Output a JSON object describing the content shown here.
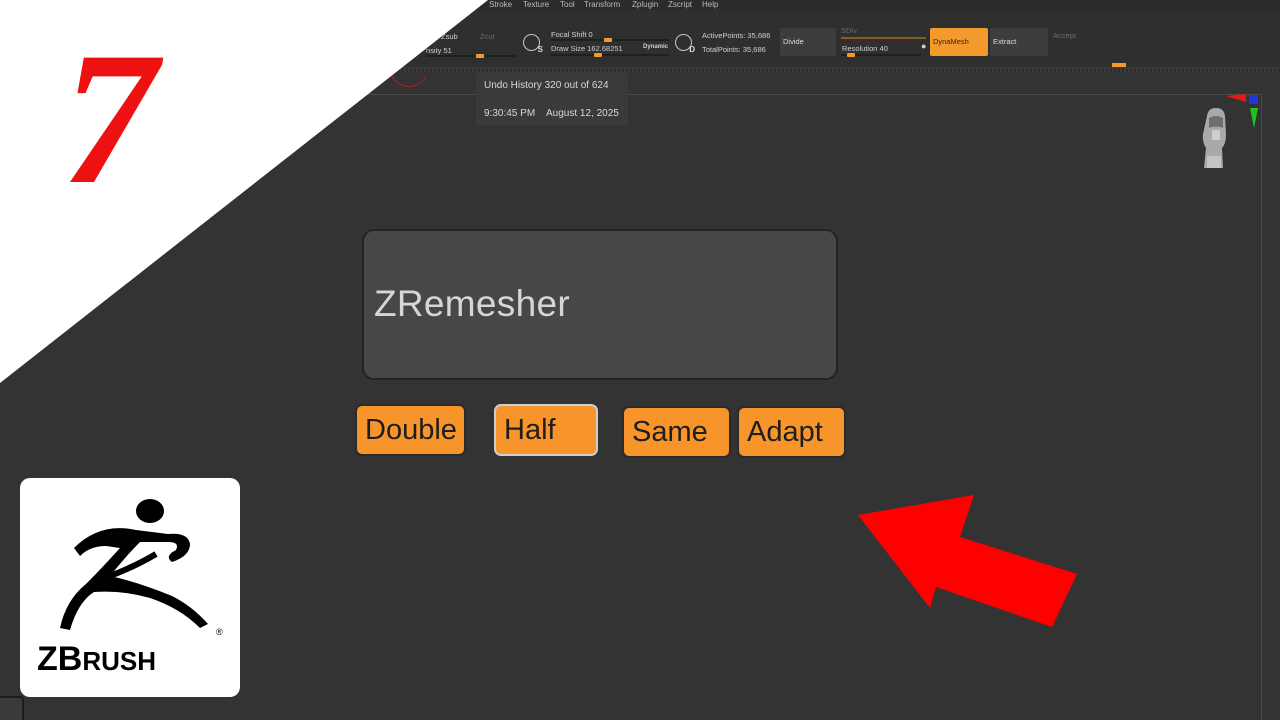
{
  "menu": [
    "Stroke",
    "Texture",
    "Tool",
    "Transform",
    "Zplugin",
    "Zscript",
    "Help"
  ],
  "toolbar": {
    "zsub": "Zsub",
    "zcut": "Zcut",
    "intensity": "nsity 51",
    "focal_shift": "Focal Shift 0",
    "draw_size": "Draw Size 162.68251",
    "dynamic": "Dynamic",
    "active_points": "ActivePoints: 35,686",
    "total_points": "TotalPoints: 35,686",
    "divide": "Divide",
    "sdiv": "SDiv",
    "resolution": "Resolution 40",
    "dynamesh": "DynaMesh",
    "extract": "Extract",
    "accept": "Accept",
    "icon_s_letter": "S",
    "icon_d_letter": "D"
  },
  "tooltip": {
    "undo_history": "Undo History 320 out of 624",
    "time": "9:30:45 PM",
    "date": "August 12, 2025"
  },
  "zremesher": {
    "label": "ZRemesher",
    "options": [
      "Double",
      "Half",
      "Same",
      "Adapt"
    ]
  },
  "overlay": {
    "episode_number": "7",
    "logo_word_big_1": "Z",
    "logo_word_big_2": "B",
    "logo_word_small": "RUSH",
    "registered": "®"
  },
  "colors": {
    "accent_orange": "#f7942a",
    "arrow_red": "#ff0000",
    "number_red": "#ee1111",
    "background": "#333333"
  },
  "icons": [
    "red-arrow-icon",
    "zbrush-logo-icon",
    "head-gizmo-icon"
  ]
}
